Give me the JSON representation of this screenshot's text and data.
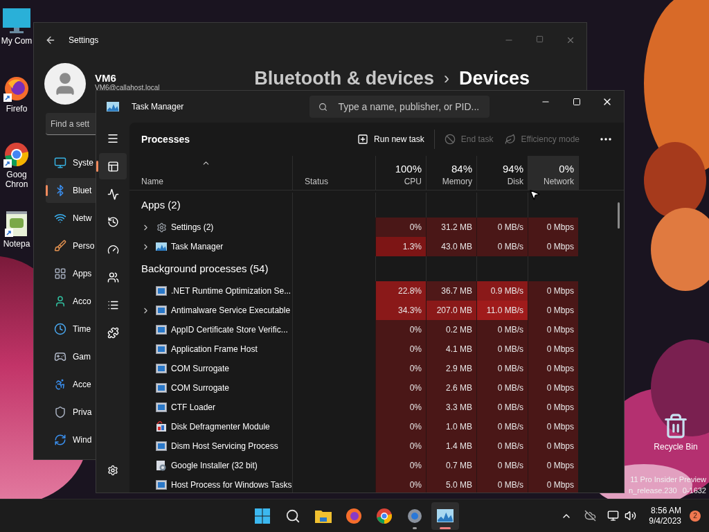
{
  "desktop": {
    "icons": [
      {
        "label": "My Com",
        "kind": "computer"
      },
      {
        "label": "Firefo",
        "kind": "firefox"
      },
      {
        "label": "Goog Chron",
        "kind": "chrome"
      },
      {
        "label": "Notepa",
        "kind": "notepad"
      }
    ],
    "recycle_bin": {
      "label": "Recycle Bin"
    },
    "build_text": [
      "11 Pro Insider Preview",
      "n_release.230",
      "0-1632"
    ]
  },
  "settings": {
    "title": "Settings",
    "user": {
      "name": "VM6",
      "email": "VM6@callahost.local"
    },
    "breadcrumb": [
      "Bluetooth & devices",
      "Devices"
    ],
    "breadcrumb_separator": "›",
    "search": {
      "placeholder": "Find a sett"
    },
    "nav": [
      {
        "label": "Syste",
        "kind": "system",
        "selected": false
      },
      {
        "label": "Bluet",
        "kind": "bluetooth",
        "selected": true
      },
      {
        "label": "Netw",
        "kind": "network",
        "selected": false
      },
      {
        "label": "Perso",
        "kind": "personalization",
        "selected": false
      },
      {
        "label": "Apps",
        "kind": "apps",
        "selected": false
      },
      {
        "label": "Acco",
        "kind": "accounts",
        "selected": false
      },
      {
        "label": "Time",
        "kind": "time",
        "selected": false
      },
      {
        "label": "Gam",
        "kind": "gaming",
        "selected": false
      },
      {
        "label": "Acce",
        "kind": "accessibility",
        "selected": false
      },
      {
        "label": "Priva",
        "kind": "privacy",
        "selected": false
      },
      {
        "label": "Wind",
        "kind": "update",
        "selected": false
      }
    ]
  },
  "task_manager": {
    "title": "Task Manager",
    "search": {
      "placeholder": "Type a name, publisher, or PID..."
    },
    "rail": [
      {
        "kind": "processes",
        "selected": true
      },
      {
        "kind": "performance",
        "selected": false
      },
      {
        "kind": "history",
        "selected": false
      },
      {
        "kind": "startup",
        "selected": false
      },
      {
        "kind": "users",
        "selected": false
      },
      {
        "kind": "details",
        "selected": false
      },
      {
        "kind": "services",
        "selected": false
      }
    ],
    "page_title": "Processes",
    "toolbar": [
      {
        "label": "Run new task",
        "kind": "run",
        "disabled": false
      },
      {
        "label": "End task",
        "kind": "end",
        "disabled": true
      },
      {
        "label": "Efficiency mode",
        "kind": "efficiency",
        "disabled": true
      }
    ],
    "columns": [
      {
        "label": "Name",
        "selected": false
      },
      {
        "label": "Status",
        "selected": false
      },
      {
        "usage": "100%",
        "label": "CPU",
        "selected": false
      },
      {
        "usage": "84%",
        "label": "Memory",
        "selected": false
      },
      {
        "usage": "94%",
        "label": "Disk",
        "selected": false
      },
      {
        "usage": "0%",
        "label": "Network",
        "selected": true
      }
    ],
    "groups": [
      {
        "title": "Apps (2)",
        "rows": [
          {
            "name": "Settings (2)",
            "kind": "gear",
            "expandable": true,
            "cells": [
              {
                "text": "0%",
                "color": "#4a1717"
              },
              {
                "text": "31.2 MB",
                "color": "#4a1717"
              },
              {
                "text": "0 MB/s",
                "color": "#4a1717"
              },
              {
                "text": "0 Mbps",
                "color": "#4a1717"
              }
            ]
          },
          {
            "name": "Task Manager",
            "kind": "chart",
            "expandable": true,
            "cells": [
              {
                "text": "1.3%",
                "color": "#7d1515"
              },
              {
                "text": "43.0 MB",
                "color": "#4a1717"
              },
              {
                "text": "0 MB/s",
                "color": "#4a1717"
              },
              {
                "text": "0 Mbps",
                "color": "#4a1717"
              }
            ]
          }
        ]
      },
      {
        "title": "Background processes (54)",
        "rows": [
          {
            "name": ".NET Runtime Optimization Se...",
            "kind": "window",
            "expandable": false,
            "cells": [
              {
                "text": "22.8%",
                "color": "#8a1919"
              },
              {
                "text": "36.7 MB",
                "color": "#4f1818"
              },
              {
                "text": "0.9 MB/s",
                "color": "#8a1919"
              },
              {
                "text": "0 Mbps",
                "color": "#4a1717"
              }
            ]
          },
          {
            "name": "Antimalware Service Executable",
            "kind": "window",
            "expandable": true,
            "cells": [
              {
                "text": "34.3%",
                "color": "#8a1919"
              },
              {
                "text": "207.0 MB",
                "color": "#8a1919"
              },
              {
                "text": "11.0 MB/s",
                "color": "#a01b1b"
              },
              {
                "text": "0 Mbps",
                "color": "#4a1717"
              }
            ]
          },
          {
            "name": "AppID Certificate Store Verific...",
            "kind": "window",
            "expandable": false,
            "cells": [
              {
                "text": "0%",
                "color": "#4a1717"
              },
              {
                "text": "0.2 MB",
                "color": "#4a1717"
              },
              {
                "text": "0 MB/s",
                "color": "#4a1717"
              },
              {
                "text": "0 Mbps",
                "color": "#4a1717"
              }
            ]
          },
          {
            "name": "Application Frame Host",
            "kind": "window",
            "expandable": false,
            "cells": [
              {
                "text": "0%",
                "color": "#4a1717"
              },
              {
                "text": "4.1 MB",
                "color": "#4a1717"
              },
              {
                "text": "0 MB/s",
                "color": "#4a1717"
              },
              {
                "text": "0 Mbps",
                "color": "#4a1717"
              }
            ]
          },
          {
            "name": "COM Surrogate",
            "kind": "window",
            "expandable": false,
            "cells": [
              {
                "text": "0%",
                "color": "#4a1717"
              },
              {
                "text": "2.9 MB",
                "color": "#4a1717"
              },
              {
                "text": "0 MB/s",
                "color": "#4a1717"
              },
              {
                "text": "0 Mbps",
                "color": "#4a1717"
              }
            ]
          },
          {
            "name": "COM Surrogate",
            "kind": "window",
            "expandable": false,
            "cells": [
              {
                "text": "0%",
                "color": "#4a1717"
              },
              {
                "text": "2.6 MB",
                "color": "#4a1717"
              },
              {
                "text": "0 MB/s",
                "color": "#4a1717"
              },
              {
                "text": "0 Mbps",
                "color": "#4a1717"
              }
            ]
          },
          {
            "name": "CTF Loader",
            "kind": "window",
            "expandable": false,
            "cells": [
              {
                "text": "0%",
                "color": "#4a1717"
              },
              {
                "text": "3.3 MB",
                "color": "#4a1717"
              },
              {
                "text": "0 MB/s",
                "color": "#4a1717"
              },
              {
                "text": "0 Mbps",
                "color": "#4a1717"
              }
            ]
          },
          {
            "name": "Disk Defragmenter Module",
            "kind": "defrag",
            "expandable": false,
            "cells": [
              {
                "text": "0%",
                "color": "#4a1717"
              },
              {
                "text": "1.0 MB",
                "color": "#4a1717"
              },
              {
                "text": "0 MB/s",
                "color": "#4a1717"
              },
              {
                "text": "0 Mbps",
                "color": "#4a1717"
              }
            ]
          },
          {
            "name": "Dism Host Servicing Process",
            "kind": "window",
            "expandable": false,
            "cells": [
              {
                "text": "0%",
                "color": "#4a1717"
              },
              {
                "text": "1.4 MB",
                "color": "#4a1717"
              },
              {
                "text": "0 MB/s",
                "color": "#4a1717"
              },
              {
                "text": "0 Mbps",
                "color": "#4a1717"
              }
            ]
          },
          {
            "name": "Google Installer (32 bit)",
            "kind": "installer",
            "expandable": false,
            "cells": [
              {
                "text": "0%",
                "color": "#4a1717"
              },
              {
                "text": "0.7 MB",
                "color": "#4a1717"
              },
              {
                "text": "0 MB/s",
                "color": "#4a1717"
              },
              {
                "text": "0 Mbps",
                "color": "#4a1717"
              }
            ]
          },
          {
            "name": "Host Process for Windows Tasks",
            "kind": "window",
            "expandable": false,
            "cells": [
              {
                "text": "0%",
                "color": "#4a1717"
              },
              {
                "text": "5.0 MB",
                "color": "#4a1717"
              },
              {
                "text": "0 MB/s",
                "color": "#4a1717"
              },
              {
                "text": "0 Mbps",
                "color": "#4a1717"
              }
            ]
          }
        ]
      }
    ]
  },
  "taskbar": {
    "apps": [
      {
        "kind": "start",
        "running": false,
        "selected": false
      },
      {
        "kind": "search",
        "running": false,
        "selected": false
      },
      {
        "kind": "explorer",
        "running": false,
        "selected": false
      },
      {
        "kind": "firefox",
        "running": false,
        "selected": false
      },
      {
        "kind": "chrome",
        "running": false,
        "selected": false
      },
      {
        "kind": "settings",
        "running": true,
        "selected": false
      },
      {
        "kind": "taskmanager",
        "running": true,
        "selected": true
      }
    ],
    "time": "8:56 AM",
    "date": "9/4/2023",
    "notifications": "2"
  }
}
